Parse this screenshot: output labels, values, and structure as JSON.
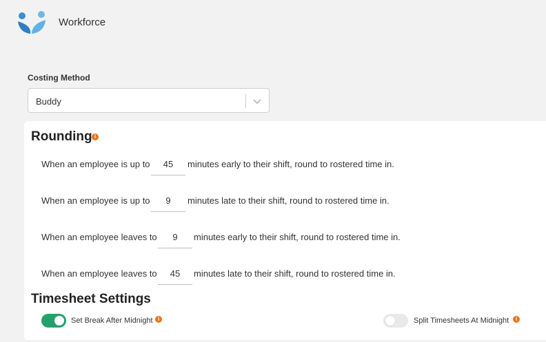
{
  "app": {
    "name": "Workforce"
  },
  "costing": {
    "label": "Costing Method",
    "selected": "Buddy"
  },
  "rounding": {
    "title": "Rounding",
    "info": "i",
    "rows": [
      {
        "prefix": "When an employee is up to",
        "value": "45",
        "suffix": "minutes early to their shift, round to rostered time in."
      },
      {
        "prefix": "When an employee is up to",
        "value": "9",
        "suffix": "minutes late to their shift, round to rostered time in."
      },
      {
        "prefix": "When an employee leaves to",
        "value": "9",
        "suffix": "minutes early to their shift, round to rostered time in."
      },
      {
        "prefix": "When an employee leaves to",
        "value": "45",
        "suffix": "minutes late to their shift, round to rostered time in."
      }
    ]
  },
  "timesheet": {
    "title": "Timesheet Settings",
    "toggles": [
      {
        "label": "Set Break After Midnight",
        "state": "on",
        "info": "i"
      },
      {
        "label": "Split Timesheets At Midnight",
        "state": "off",
        "info": "i"
      }
    ]
  },
  "colors": {
    "accent_green": "#24a06b",
    "info_orange": "#e8731c",
    "logo_blue": "#3a8fd0"
  }
}
